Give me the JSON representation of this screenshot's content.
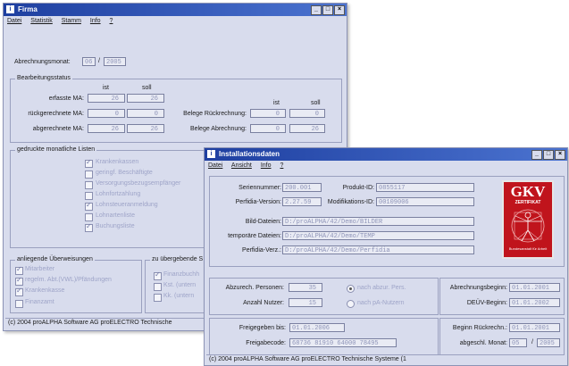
{
  "firma": {
    "title": "Firma",
    "menu": [
      "Datei",
      "Statistik",
      "Stamm",
      "Info",
      "?"
    ],
    "abrechnungsmonat": {
      "label": "Abrechnungsmonat:",
      "month": "06",
      "sep": "/",
      "year": "2005"
    },
    "bearbeitungsstatus": {
      "title": "Bearbeitungsstatus",
      "ist": "ist",
      "soll": "soll",
      "rows": [
        {
          "label": "erfasste MA:",
          "ist": "26",
          "soll": "26"
        },
        {
          "label": "rückgerechnete MA:",
          "ist": "0",
          "soll": "0"
        },
        {
          "label": "abgerechnete MA:",
          "ist": "26",
          "soll": "26"
        }
      ],
      "right_rows": [
        {
          "label": "Belege Rückrechnung:",
          "ist": "0",
          "soll": "0"
        },
        {
          "label": "Belege Abrechnung:",
          "ist": "0",
          "soll": "26"
        }
      ]
    },
    "listen": {
      "title": "gedruckte monatliche Listen",
      "items": [
        {
          "label": "Krankenkassen",
          "checked": true
        },
        {
          "label": "geringf. Beschäftigte",
          "checked": false
        },
        {
          "label": "Versorgungsbezugsempfänger",
          "checked": false
        },
        {
          "label": "Lohnfortzahlung",
          "checked": false
        },
        {
          "label": "Lohnsteueranmeldung",
          "checked": true
        },
        {
          "label": "Lohnartenliste",
          "checked": false
        },
        {
          "label": "Buchungsliste",
          "checked": true
        }
      ]
    },
    "ueberweisungen": {
      "title": "anliegende Überweisungen",
      "items": [
        {
          "label": "Mitarbeiter",
          "checked": true
        },
        {
          "label": "regelm. Abt.(VWL)/Pfändungen",
          "checked": true
        },
        {
          "label": "Krankenkasse",
          "checked": true
        },
        {
          "label": "Finanzamt",
          "checked": false
        }
      ]
    },
    "uebergebende": {
      "title": "zu übergebende S",
      "items": [
        {
          "label": "Finanzbuchh",
          "checked": true
        },
        {
          "label": "Kst. (untern",
          "checked": false
        },
        {
          "label": "Kk. (untern",
          "checked": false
        }
      ]
    },
    "status": "(c) 2004 proALPHA Software AG  proELECTRO Technische"
  },
  "install": {
    "title": "Installationsdaten",
    "menu": [
      "Datei",
      "Ansicht",
      "Info",
      "?"
    ],
    "seriennummer": {
      "label": "Seriennummer:",
      "value": "200.001"
    },
    "perfidia_version": {
      "label": "Perfidia-Version:",
      "value": "2.27.59"
    },
    "produkt_id": {
      "label": "Produkt-ID:",
      "value": "0855117"
    },
    "modifikations_id": {
      "label": "Modifikations-ID:",
      "value": "00109006"
    },
    "bild_dateien": {
      "label": "Bild-Dateien:",
      "value": "D:/proALPHA/42/Demo/BILDER"
    },
    "temp_dateien": {
      "label": "temporäre Dateien:",
      "value": "D:/proALPHA/42/Demo/TEMP"
    },
    "perfidia_verz": {
      "label": "Perfidia-Verz.:",
      "value": "D:/proALPHA/42/Demo/Perfidia"
    },
    "gkv": {
      "text": "GKV",
      "sub": "ZERTIFIKAT",
      "caption": "Bundesanstalt für Arbeit"
    },
    "abzurech": {
      "label": "Abzurech. Personen:",
      "value": "35",
      "radio": "nach abzur. Pers."
    },
    "anzahl_nutzer": {
      "label": "Anzahl Nutzer:",
      "value": "15",
      "radio": "nach pA-Nutzern"
    },
    "abrechnungsbeginn": {
      "label": "Abrechnungsbeginn:",
      "value": "01.01.2001"
    },
    "deuev_beginn": {
      "label": "DEÜV-Beginn:",
      "value": "01.01.2002"
    },
    "freigegeben_bis": {
      "label": "Freigegeben bis:",
      "value": "01.01.2006"
    },
    "freigabecode": {
      "label": "Freigabecode:",
      "value": "68736 81910 64000 78495"
    },
    "beginn_rueck": {
      "label": "Beginn Rückrechn.:",
      "value": "01.01.2001"
    },
    "abgeschl_monat": {
      "label": "abgeschl. Monat:",
      "month": "05",
      "sep": "/",
      "year": "2005"
    },
    "status": "(c) 2004 proALPHA Software AG  proELECTRO Technische Systeme (1"
  },
  "icons": {
    "app": "app-icon",
    "min": "minimize-icon",
    "max": "maximize-icon",
    "close": "close-icon"
  }
}
